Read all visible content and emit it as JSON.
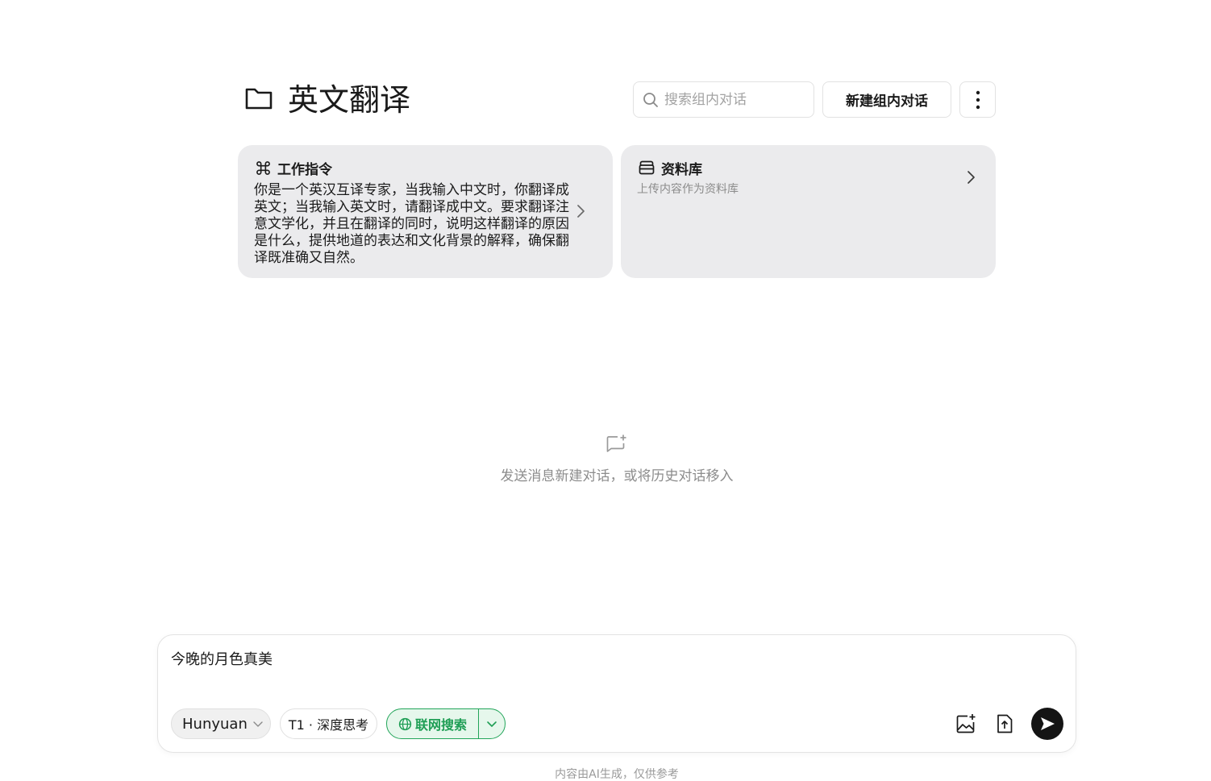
{
  "group": {
    "title": "英文翻译",
    "search_placeholder": "搜索组内对话",
    "new_chat_label": "新建组内对话"
  },
  "instruction_card": {
    "title": "工作指令",
    "text": "你是一个英汉互译专家，当我输入中文时，你翻译成英文；当我输入英文时，请翻译成中文。要求翻译注意文学化，并且在翻译的同时，说明这样翻译的原因是什么，提供地道的表达和文化背景的解释，确保翻译既准确又自然。"
  },
  "library_card": {
    "title": "资料库",
    "subtitle": "上传内容作为资料库"
  },
  "empty_state": {
    "text": "发送消息新建对话，或将历史对话移入"
  },
  "composer": {
    "input_value": "今晚的月色真美",
    "model_label": "Hunyuan",
    "mode_label": "T1 · 深度思考",
    "web_search_label": "联网搜索"
  },
  "footer": {
    "disclaimer": "内容由AI生成，仅供参考"
  },
  "colors": {
    "accent_green": "#23a55a",
    "card_bg": "#ebebed",
    "send_bg": "#141414"
  }
}
